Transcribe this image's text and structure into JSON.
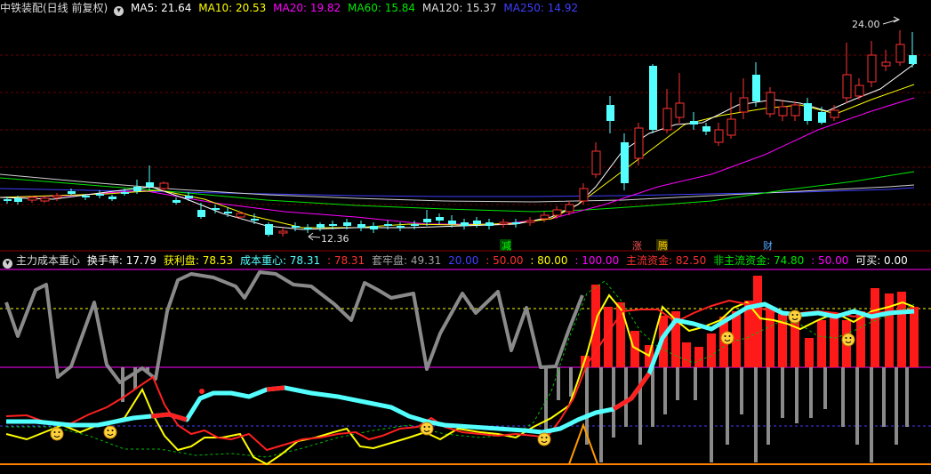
{
  "top_legend": {
    "stock": "中铁装配(日线 前复权)",
    "ma5": "MA5: 21.64",
    "ma10": "MA10: 20.53",
    "ma20": "MA20: 19.82",
    "ma60": "MA60: 15.84",
    "ma120": "MA120: 15.37",
    "ma250": "MA250: 14.92"
  },
  "indicator_legend": {
    "name": "主力成本重心",
    "turnover": "换手率: 17.79",
    "profit": "获利盘: 78.53",
    "cost_center": "成本重心: 78.31",
    "cost_center_2": ": 78.31",
    "trapped": "套牢盘: 49.31",
    "lvl20": "20.00",
    "lvl50": ": 50.00",
    "lvl80": ": 80.00",
    "lvl100": ": 100.00",
    "main_funds": "主流资金: 82.50",
    "non_main_funds": "非主流资金: 74.80",
    "lvl50b": ": 50.00",
    "can_buy": "可买: 0.00"
  },
  "price_labels": {
    "high": "24.00",
    "low": "12.36"
  },
  "markers": {
    "jian": "减",
    "zhang": "涨",
    "teng": "腾",
    "cai": "财"
  },
  "colors": {
    "up": "#ff3232",
    "down": "#54ffff",
    "ma5": "#ffffff",
    "ma10": "#ffff00",
    "ma20": "#ff00ff",
    "ma60": "#00e600",
    "ma250": "#3f3fff",
    "gray_line": "#8a8a8a",
    "grid_red": "#8b0000"
  }
}
